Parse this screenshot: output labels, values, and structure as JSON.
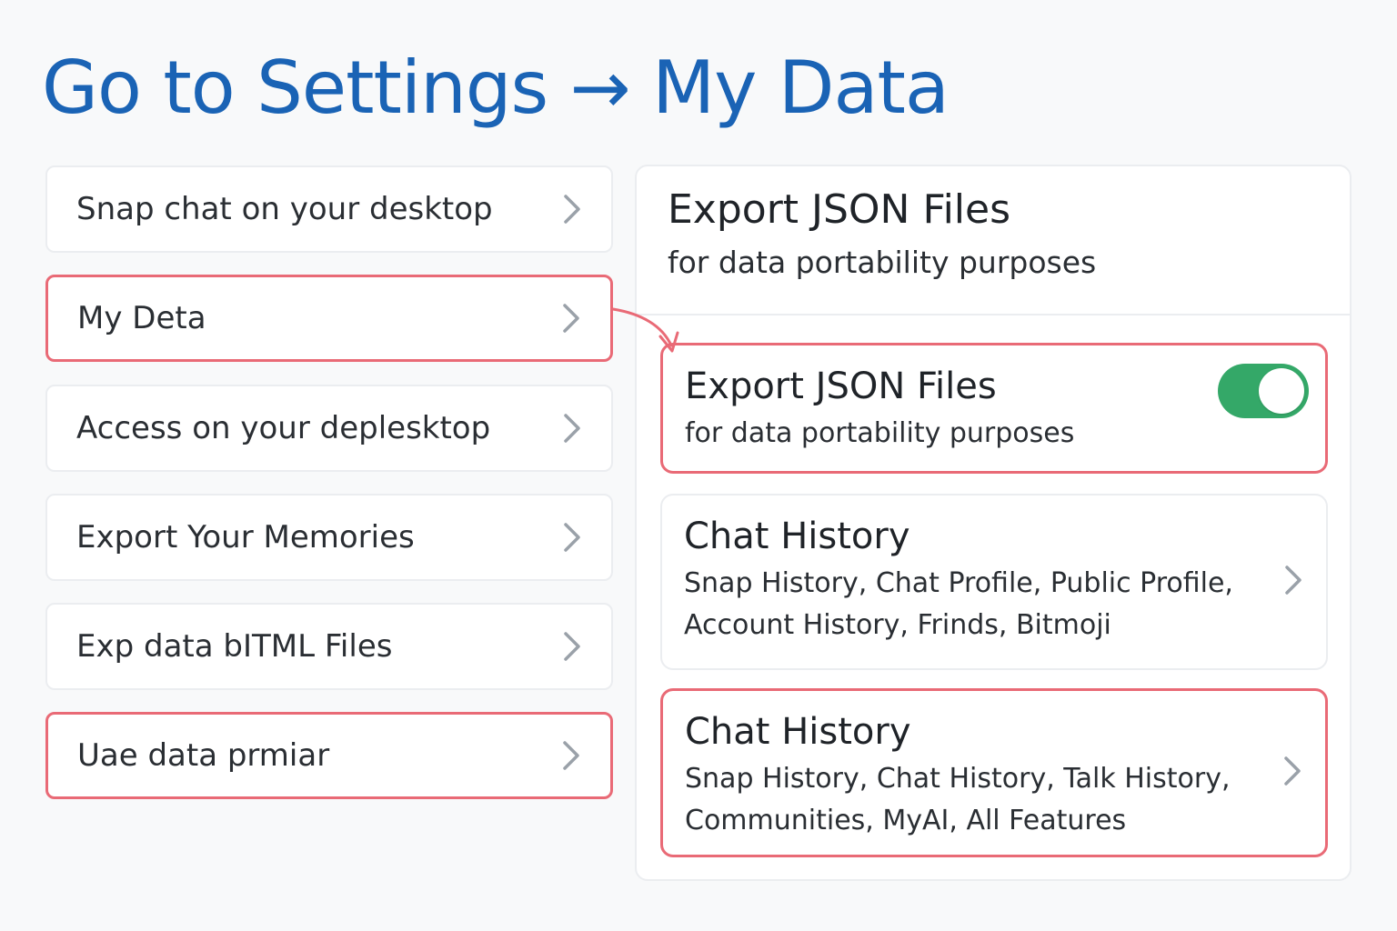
{
  "page": {
    "title": "Go to Settings → My Data"
  },
  "menu": {
    "items": [
      {
        "label": "Snap chat on your desktop",
        "highlighted": false
      },
      {
        "label": "My Deta",
        "highlighted": true
      },
      {
        "label": "Access on your deplesktop",
        "highlighted": false
      },
      {
        "label": "Export Your Memories",
        "highlighted": false
      },
      {
        "label": "Exp data bITML Files",
        "highlighted": false
      },
      {
        "label": "Uae data prmiar",
        "highlighted": true
      }
    ]
  },
  "panel": {
    "header": {
      "title": "Export JSON Files",
      "subtitle": "for data portability purposes"
    },
    "json_card": {
      "title": "Export JSON Files",
      "subtitle": "for data portability purposes",
      "toggle_on": true
    },
    "chat_card_1": {
      "title": "Chat History",
      "line1": "Snap History, Chat Profile, Public Profile,",
      "line2": "Account History, Frinds, Bitmoji"
    },
    "chat_card_2": {
      "title": "Chat History",
      "line1": "Snap History, Chat History, Talk History,",
      "line2": "Communities, MyAI, All Features"
    }
  },
  "icons": {
    "chevron": "chevron-right-icon",
    "connector": "curved-arrow-icon"
  },
  "colors": {
    "title_blue": "#1a63b5",
    "highlight_red": "#e96a76",
    "toggle_green": "#34a868",
    "chevron_gray": "#9aa1a9"
  }
}
